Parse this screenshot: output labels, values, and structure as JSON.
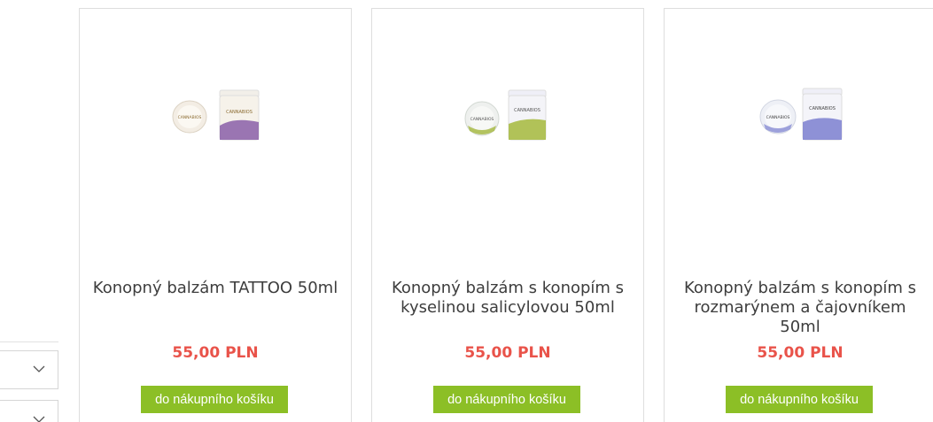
{
  "sidebar": {
    "filters": [
      {
        "icon": "chevron-down-icon"
      },
      {
        "icon": "chevron-down-icon"
      }
    ]
  },
  "products": [
    {
      "name": "Konopný balzám TATTOO 50ml",
      "price": "55,00 PLN",
      "cart_label": "do nákupního košíku",
      "accent": "#8a5fa8",
      "brand": "CANNABIOS"
    },
    {
      "name": "Konopný balzám s konopím s kyselinou salicylovou 50ml",
      "price": "55,00 PLN",
      "cart_label": "do nákupního košíku",
      "accent": "#a4b83c",
      "brand": "CANNABIOS"
    },
    {
      "name": "Konopný balzám s konopím s rozmarýnem a čajovníkem 50ml",
      "price": "55,00 PLN",
      "cart_label": "do nákupního košíku",
      "accent": "#7b7fd0",
      "brand": "CANNABIOS"
    }
  ],
  "colors": {
    "price": "#e9534a",
    "cart_button": "#8cbf26",
    "card_border": "#dedede"
  }
}
